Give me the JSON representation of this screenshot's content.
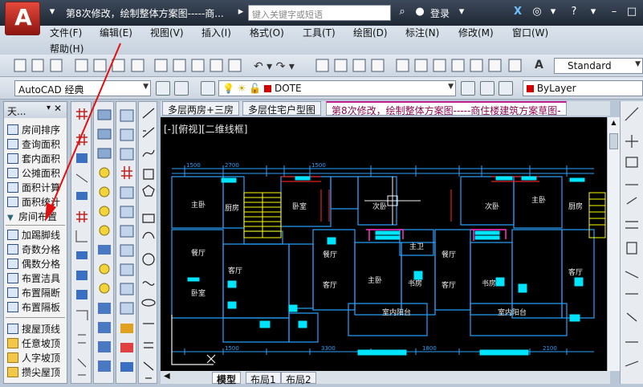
{
  "title_bar": {
    "app_letter": "A",
    "title": "第8次修改，绘制整体方案图-----商...",
    "search_placeholder": "键入关键字或短语",
    "login_label": "登录"
  },
  "menu": {
    "items": [
      "文件(F)",
      "编辑(E)",
      "视图(V)",
      "插入(I)",
      "格式(O)",
      "工具(T)",
      "绘图(D)",
      "标注(N)",
      "修改(M)",
      "窗口(W)"
    ],
    "help": "帮助(H)"
  },
  "toolbar": {
    "text_style": "Standard",
    "workspace": "AutoCAD 经典",
    "layer": "DOTE",
    "color": "ByLayer",
    "color_swatch": "#d00000"
  },
  "palette": {
    "title": "天...",
    "items": [
      "房间排序",
      "查询面积",
      "套内面积",
      "公摊面积",
      "面积计算",
      "面积统计",
      "房间布置",
      "加踢脚线",
      "奇数分格",
      "偶数分格",
      "布置洁具",
      "布置隔断",
      "布置隔板",
      "搜屋顶线",
      "任意坡顶",
      "人字坡顶",
      "攒尖屋顶"
    ]
  },
  "doc_tabs": [
    "多层两房+三房",
    "多层住宅户型图",
    "第8次修改，绘制整体方案图-----商住楼建筑方案草图-"
  ],
  "viewport_label": "[-][俯视][二维线框]",
  "layout_tabs": [
    "模型",
    "布局1",
    "布局2"
  ],
  "drawing": {
    "room_labels": [
      "主卧",
      "厨房",
      "卧室",
      "客厅",
      "餐厅",
      "卧室",
      "次卧",
      "主卫",
      "餐厅",
      "客厅",
      "主卧",
      "书房",
      "餐厅",
      "客厅",
      "书房",
      "室内阳台",
      "室内阳台",
      "次卧",
      "厨房",
      "客厅",
      "主卧"
    ],
    "dims": [
      "1500",
      "2700",
      "1500",
      "1500",
      "3300",
      "1800",
      "2100"
    ]
  },
  "colors": {
    "wall": "#2aa3ff",
    "window": "#00e5ff",
    "stair": "#ffff00",
    "red_line": "#e02020",
    "magenta": "#ff33cc"
  }
}
